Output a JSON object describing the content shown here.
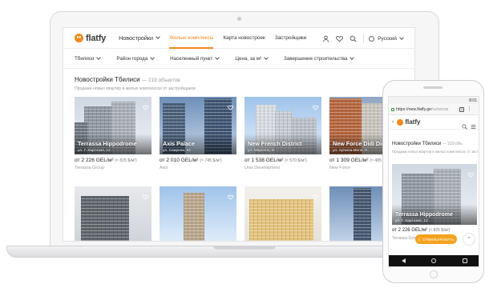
{
  "site": {
    "logo_text": "flatfy",
    "nav": {
      "main_label": "Новостройки",
      "items": [
        "Жилые комплексы",
        "Карта новостроек",
        "Застройщики"
      ]
    },
    "language": "Русский"
  },
  "filters": [
    "Тбилиси",
    "Район города",
    "Населенный пункт",
    "Цена, за м²",
    "Завершение строительства"
  ],
  "listing": {
    "title": "Новостройки Тбилиси",
    "count": "— 219 объектов",
    "subtitle": "Продажа новых квартир в жилых комплексах от застройщиков"
  },
  "cards": [
    {
      "name": "Terrassa Hippodrome",
      "address": "ул. Г. Картозия, 12",
      "price": "от 2 226 GEL/м²",
      "usd": "(≈ 825 $/м²)",
      "developer": "Terrassa Group"
    },
    {
      "name": "Axis Palace",
      "address": "ул. Свирени, 51",
      "price": "от 2 010 GEL/м²",
      "usd": "(≈ 745 $/м²)",
      "developer": "Axis"
    },
    {
      "name": "New French District",
      "address": "ул. Марсель, 9",
      "price": "от 1 538 GEL/м²",
      "usd": "(≈ 570 $/м²)",
      "developer": "Unix Development"
    },
    {
      "name": "New Force Didi Digo",
      "address": "ул. Арчила Мепе, 9",
      "price": "от 1 309 GEL/м²",
      "usd": "(≈ 485 $",
      "developer": "New Force"
    }
  ],
  "phone": {
    "status_time": "8:01",
    "url_host": "https://new.flatfy.ge",
    "url_path": "/ru/novos",
    "tab_count": "1",
    "logo_text": "flatfy",
    "title": "Новостройки Тбилиси",
    "count": "— 219 объ",
    "subtitle": "Продажа новых квартир в жилых комплексах от застройщ",
    "card": {
      "name": "Terrassa Hippodrome",
      "address": "ул. Г. Картозия, 12",
      "price": "от 2 226 GEL/м²",
      "usd": "(≈ 825 $/м²)",
      "developer": "Terrassa Group"
    },
    "filter_button": "ОТФИЛЬТРОВАТЬ"
  },
  "colors": {
    "accent": "#f28a1b",
    "filter_button": "#f5a21e"
  }
}
